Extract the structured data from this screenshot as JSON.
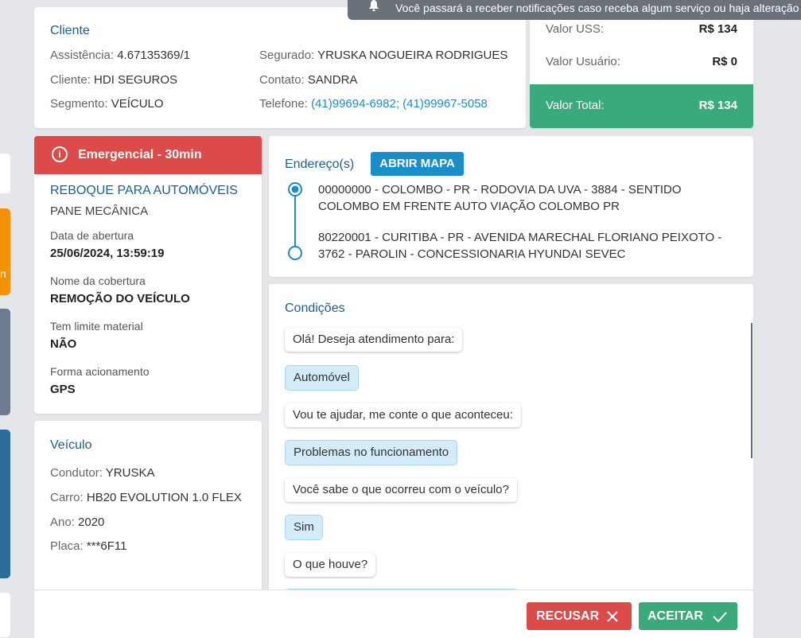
{
  "notification": {
    "text": "Você passará a receber notificações caso receba algum serviço ou haja alteração",
    "icon": "bell-icon"
  },
  "cliente": {
    "title": "Cliente",
    "assistencia_label": "Assistência:",
    "assistencia_value": "4.67135369/1",
    "cliente_label": "Cliente:",
    "cliente_value": "HDI SEGUROS",
    "segmento_label": "Segmento:",
    "segmento_value": "VEÍCULO",
    "segurado_label": "Segurado:",
    "segurado_value": "YRUSKA NOGUEIRA RODRIGUES",
    "contato_label": "Contato:",
    "contato_value": "SANDRA",
    "telefone_label": "Telefone:",
    "telefone_value": "(41)99694-6982; (41)99967-5058"
  },
  "valores": {
    "uss_label": "Valor USS:",
    "uss_value": "R$ 134",
    "usuario_label": "Valor Usuário:",
    "usuario_value": "R$ 0",
    "total_label": "Valor Total:",
    "total_value": "R$ 134",
    "total_color": "#3aaa7c"
  },
  "servico": {
    "badge": "Emergencial - 30min",
    "badge_color": "#dc4a4a",
    "tipo": "REBOQUE PARA AUTOMÓVEIS",
    "subtipo": "PANE MECÂNICA",
    "data_label": "Data de abertura",
    "data_value": "25/06/2024, 13:59:19",
    "cobertura_label": "Nome da cobertura",
    "cobertura_value": "REMOÇÃO DO VEÍCULO",
    "limite_label": "Tem limite material",
    "limite_value": "NÃO",
    "acionamento_label": "Forma acionamento",
    "acionamento_value": "GPS"
  },
  "veiculo": {
    "title": "Veículo",
    "condutor_label": "Condutor:",
    "condutor_value": "YRUSKA",
    "carro_label": "Carro:",
    "carro_value": "HB20 EVOLUTION 1.0 FLEX",
    "ano_label": "Ano:",
    "ano_value": "2020",
    "placa_label": "Placa:",
    "placa_value": "***6F11"
  },
  "enderecos": {
    "title": "Endereço(s)",
    "map_button": "ABRIR MAPA",
    "origem_line1": "00000000 - COLOMBO - PR - RODOVIA DA UVA - 3884 - SENTIDO",
    "origem_line2": "COLOMBO EM FRENTE AUTO VIAÇÃO COLOMBO PR",
    "destino_line1": "80220001 - CURITIBA - PR - AVENIDA MARECHAL FLORIANO PEIXOTO -",
    "destino_line2": "3762 - PAROLIN - CONCESSIONARIA HYUNDAI SEVEC"
  },
  "condicoes": {
    "title": "Condições",
    "messages": [
      {
        "text": "Olá! Deseja atendimento para:"
      },
      {
        "text": "Automóvel"
      },
      {
        "text": "Vou te ajudar, me conte o que aconteceu:"
      },
      {
        "text": "Problemas no funcionamento"
      },
      {
        "text": "Você sabe o que ocorreu com o veículo?"
      },
      {
        "text": "Sim"
      },
      {
        "text": "O que houve?"
      }
    ]
  },
  "actions": {
    "recusar": "RECUSAR",
    "aceitar": "ACEITAR",
    "recusar_color": "#dc4a4a",
    "aceitar_color": "#3aaa7c"
  }
}
